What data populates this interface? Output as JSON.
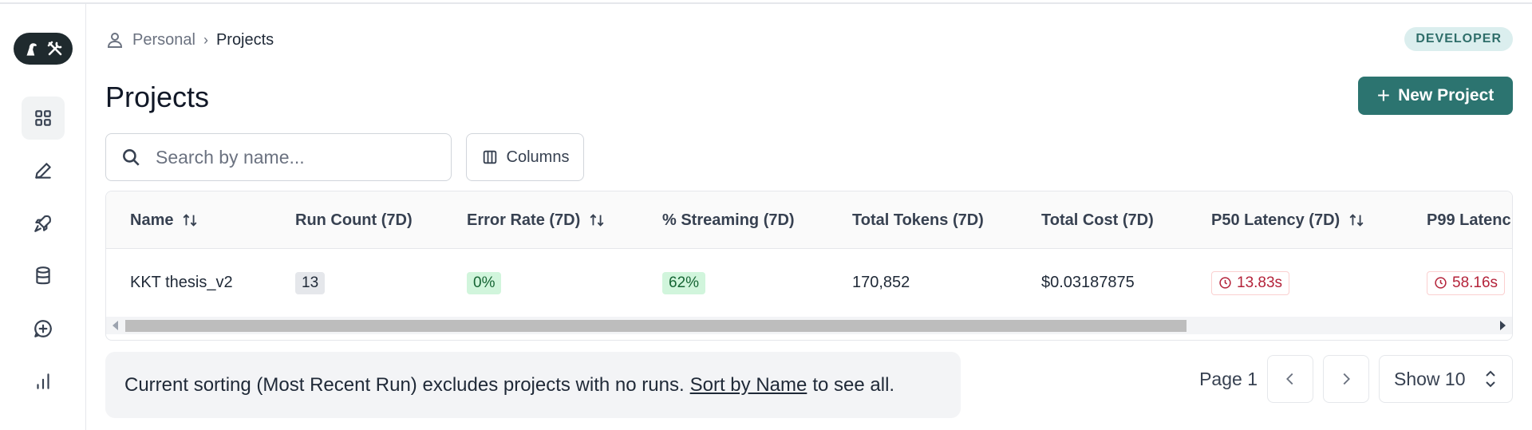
{
  "breadcrumb": {
    "parent": "Personal",
    "separator": "›",
    "current": "Projects"
  },
  "badge": "DEVELOPER",
  "page": {
    "title": "Projects",
    "new_button": "New Project",
    "new_button_icon": "plus-icon"
  },
  "search": {
    "placeholder": "Search by name...",
    "value": ""
  },
  "columns_button": "Columns",
  "table": {
    "headers": [
      "Name",
      "Run Count (7D)",
      "Error Rate (7D)",
      "% Streaming (7D)",
      "Total Tokens (7D)",
      "Total Cost (7D)",
      "P50 Latency (7D)",
      "P99 Latenc"
    ],
    "sortable": [
      true,
      false,
      true,
      false,
      false,
      false,
      true,
      false
    ],
    "rows": [
      {
        "name": "KKT thesis_v2",
        "run_count": "13",
        "error_rate": "0%",
        "streaming": "62%",
        "tokens": "170,852",
        "cost": "$0.03187875",
        "p50": "13.83s",
        "p99": "58.16s"
      }
    ]
  },
  "notice": {
    "before": "Current sorting (Most Recent Run) excludes projects with no runs.",
    "link": "Sort by Name",
    "after": "to see all."
  },
  "pagination": {
    "page_label": "Page 1",
    "show": "Show 10"
  },
  "colors": {
    "accent": "#2c7470",
    "badge_bg": "#dbeeee",
    "error_text": "#b4233a",
    "success_bg": "#d1f5dc"
  },
  "sidebar": {
    "items": [
      "grid-icon",
      "pen-icon",
      "rocket-icon",
      "database-icon",
      "chat-plus-icon",
      "bar-chart-icon"
    ]
  }
}
